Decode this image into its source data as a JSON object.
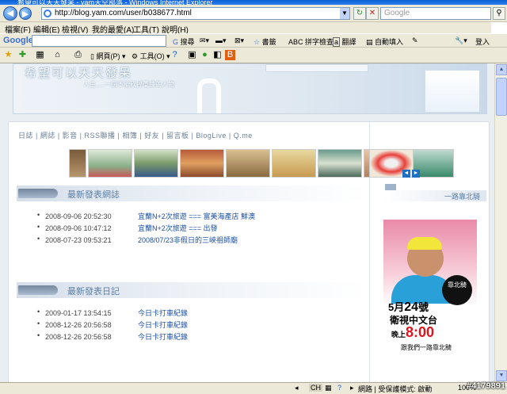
{
  "window": {
    "title": "希望可以天天發呆 - yam天空部落 - Windows Internet Explorer"
  },
  "address": {
    "url": "http://blog.yam.com/user/b038677.html"
  },
  "google_search": {
    "placeholder": "Google"
  },
  "menu": [
    "檔案(F)",
    "編輯(E)",
    "檢視(V)",
    "我的最愛(A)",
    "工具(T)",
    "說明(H)"
  ],
  "google_toolbar": {
    "logo": "Google",
    "items": [
      "搜尋",
      "書籤",
      "拼字檢查",
      "翻譯",
      "自動填入",
      "登入"
    ]
  },
  "favorites_bar": {
    "items": [
      "網頁(P)",
      "工具(O)"
    ]
  },
  "banner": {
    "title": "希望可以天天發呆",
    "subtitle": "人生.....一個不能砍掉重練的人物"
  },
  "nav_links": "日誌 | 網誌 | 影音 | RSS聯播 | 相簿 | 好友 | 留言板 | BlogLive | Q.me",
  "recent_posts": {
    "title": "最新發表網誌",
    "items": [
      {
        "date": "2008-09-06 20:52:30",
        "text": "宜蘭N+2次旅遊 === 富美海產店 鮮澳"
      },
      {
        "date": "2008-09-06 10:47:12",
        "text": "宜蘭N+2次旅遊 === 出發"
      },
      {
        "date": "2008-07-23 09:53:21",
        "text": "2008/07/23非假日的三峽祖師廟"
      }
    ]
  },
  "recent_diary": {
    "title": "最新發表日記",
    "items": [
      {
        "date": "2009-01-17 13:54:15",
        "text": "今日卡打車紀錄"
      },
      {
        "date": "2008-12-26 20:56:58",
        "text": "今日卡打車紀錄"
      },
      {
        "date": "2008-12-26 20:56:58",
        "text": "今日卡打車紀錄"
      }
    ]
  },
  "sidebar": {
    "ride_title": "一路靠北騎",
    "ad": {
      "logo": "靠北騎",
      "date_prefix": "5月",
      "date_day": "24",
      "date_suffix": "號",
      "channel": "衛視中文台",
      "time_prefix": "晚上",
      "time": "8:00",
      "tagline": "跟我們一路靠北騎"
    }
  },
  "status": {
    "text": "網路 | 受保護模式: 啟動",
    "zoom": "100%",
    "ime": "CH"
  },
  "watermark": "#4179891"
}
